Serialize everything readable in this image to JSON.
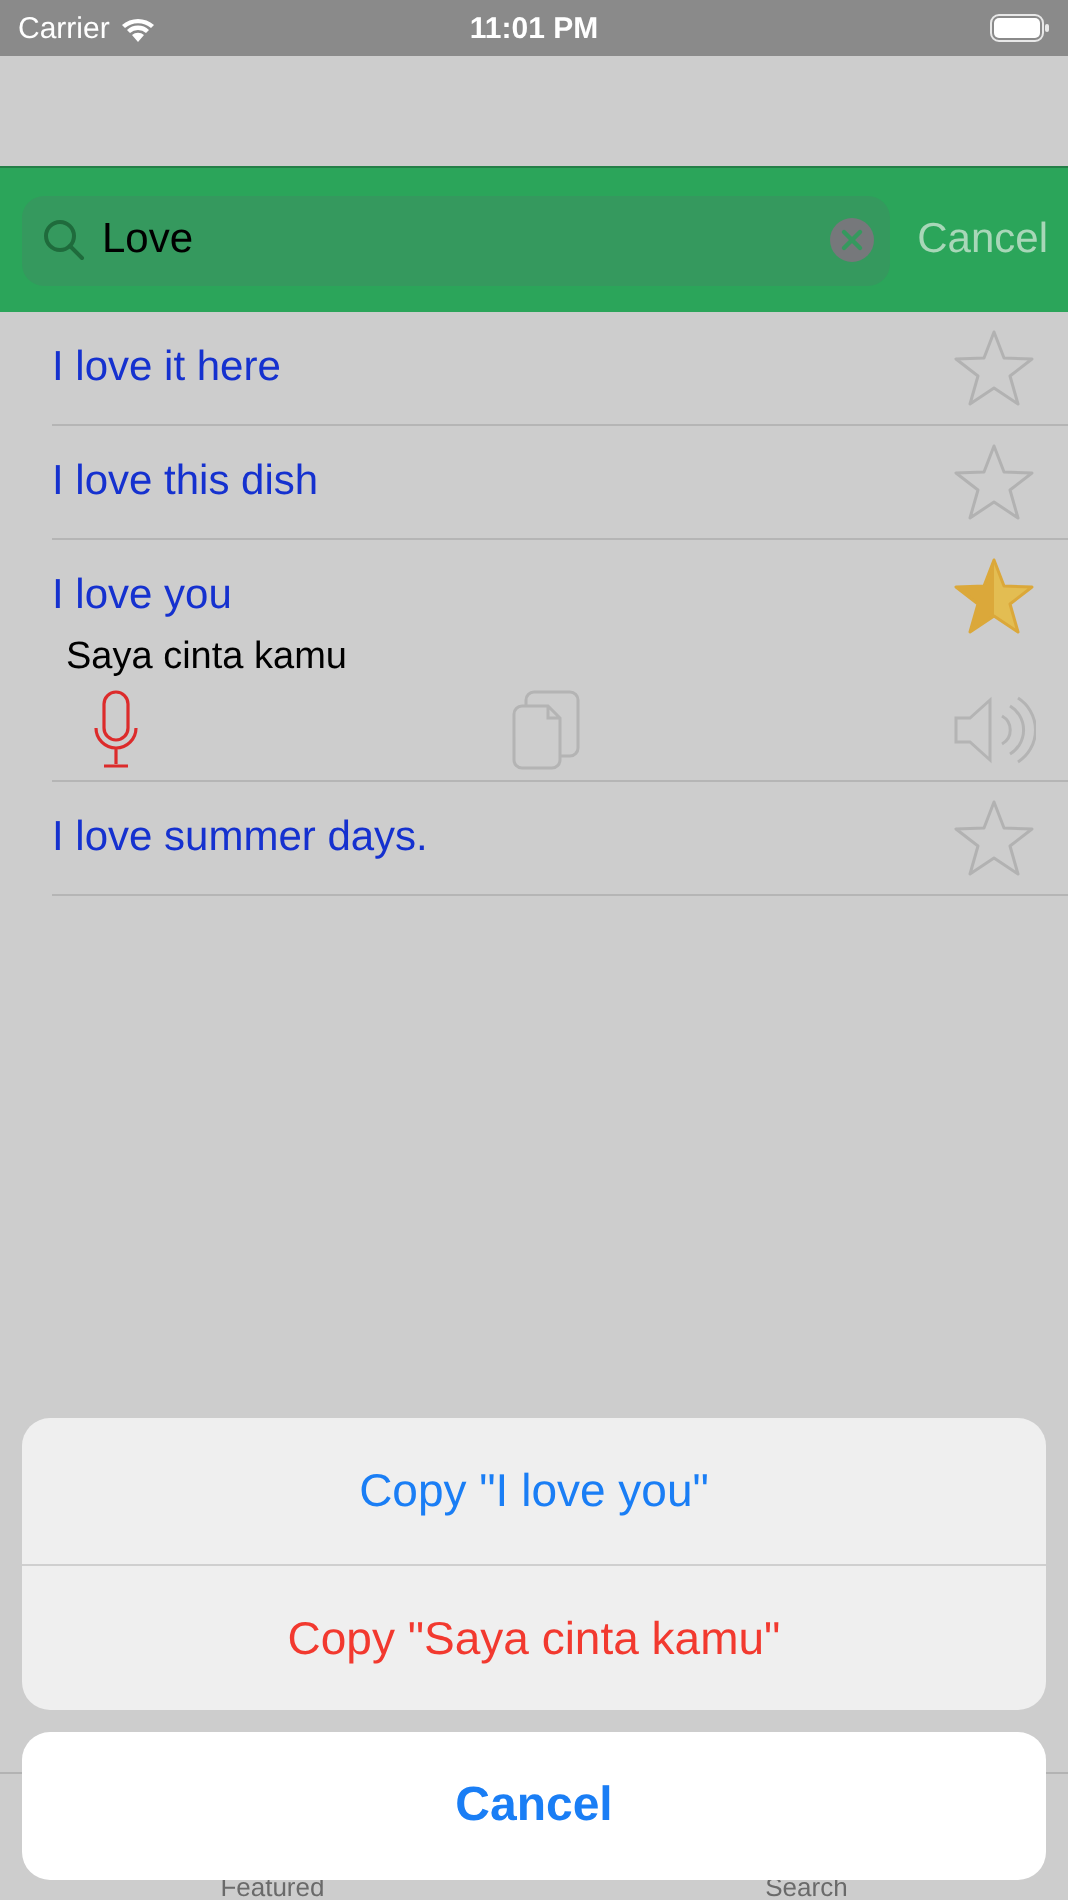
{
  "status_bar": {
    "carrier": "Carrier",
    "time": "11:01 PM"
  },
  "search": {
    "value": "Love",
    "cancel": "Cancel"
  },
  "results": [
    {
      "text": "I love it here",
      "favorite": false,
      "expanded": false
    },
    {
      "text": "I love this dish",
      "favorite": false,
      "expanded": false
    },
    {
      "text": "I love you",
      "favorite": true,
      "expanded": true,
      "translation": "Saya cinta kamu"
    },
    {
      "text": "I love summer days.",
      "favorite": false,
      "expanded": false
    }
  ],
  "tab_bar": {
    "tabs": [
      {
        "label": "Featured"
      },
      {
        "label": "Search"
      }
    ]
  },
  "action_sheet": {
    "actions": [
      {
        "label": "Copy \"I love you\"",
        "kind": "default"
      },
      {
        "label": "Copy \"Saya cinta kamu\"",
        "kind": "destructive"
      }
    ],
    "cancel": "Cancel"
  }
}
